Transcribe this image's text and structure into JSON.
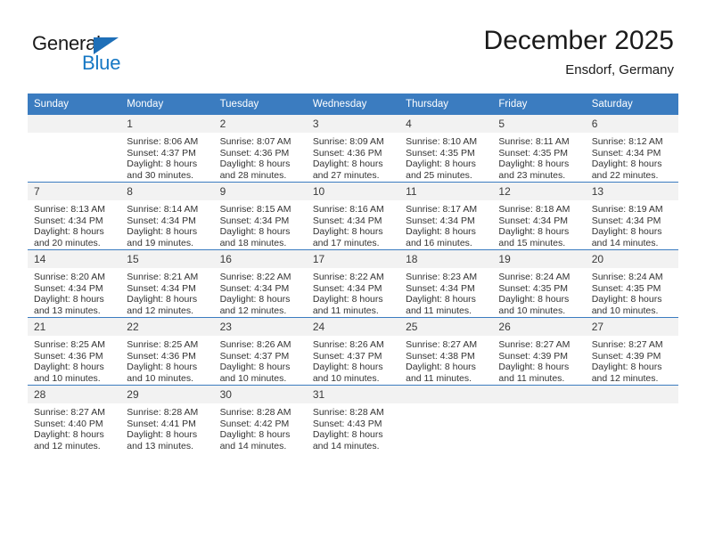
{
  "brand": {
    "name_top": "General",
    "name_bottom": "Blue",
    "triangle_color": "#1e6fb8",
    "blue_text_color": "#1577c4"
  },
  "header": {
    "title": "December 2025",
    "location": "Ensdorf, Germany"
  },
  "theme": {
    "header_blue": "#3b7cc0",
    "daynum_band": "#f2f2f2",
    "text": "#333333"
  },
  "calendar": {
    "weekday_headers": [
      "Sunday",
      "Monday",
      "Tuesday",
      "Wednesday",
      "Thursday",
      "Friday",
      "Saturday"
    ],
    "labels": {
      "sunrise": "Sunrise:",
      "sunset": "Sunset:",
      "daylight": "Daylight:"
    },
    "weeks": [
      [
        {
          "day": "",
          "empty": true,
          "l1": "",
          "l2": "",
          "l3": "",
          "l4": ""
        },
        {
          "day": "1",
          "l1": "Sunrise: 8:06 AM",
          "l2": "Sunset: 4:37 PM",
          "l3": "Daylight: 8 hours",
          "l4": "and 30 minutes."
        },
        {
          "day": "2",
          "l1": "Sunrise: 8:07 AM",
          "l2": "Sunset: 4:36 PM",
          "l3": "Daylight: 8 hours",
          "l4": "and 28 minutes."
        },
        {
          "day": "3",
          "l1": "Sunrise: 8:09 AM",
          "l2": "Sunset: 4:36 PM",
          "l3": "Daylight: 8 hours",
          "l4": "and 27 minutes."
        },
        {
          "day": "4",
          "l1": "Sunrise: 8:10 AM",
          "l2": "Sunset: 4:35 PM",
          "l3": "Daylight: 8 hours",
          "l4": "and 25 minutes."
        },
        {
          "day": "5",
          "l1": "Sunrise: 8:11 AM",
          "l2": "Sunset: 4:35 PM",
          "l3": "Daylight: 8 hours",
          "l4": "and 23 minutes."
        },
        {
          "day": "6",
          "l1": "Sunrise: 8:12 AM",
          "l2": "Sunset: 4:34 PM",
          "l3": "Daylight: 8 hours",
          "l4": "and 22 minutes."
        }
      ],
      [
        {
          "day": "7",
          "l1": "Sunrise: 8:13 AM",
          "l2": "Sunset: 4:34 PM",
          "l3": "Daylight: 8 hours",
          "l4": "and 20 minutes."
        },
        {
          "day": "8",
          "l1": "Sunrise: 8:14 AM",
          "l2": "Sunset: 4:34 PM",
          "l3": "Daylight: 8 hours",
          "l4": "and 19 minutes."
        },
        {
          "day": "9",
          "l1": "Sunrise: 8:15 AM",
          "l2": "Sunset: 4:34 PM",
          "l3": "Daylight: 8 hours",
          "l4": "and 18 minutes."
        },
        {
          "day": "10",
          "l1": "Sunrise: 8:16 AM",
          "l2": "Sunset: 4:34 PM",
          "l3": "Daylight: 8 hours",
          "l4": "and 17 minutes."
        },
        {
          "day": "11",
          "l1": "Sunrise: 8:17 AM",
          "l2": "Sunset: 4:34 PM",
          "l3": "Daylight: 8 hours",
          "l4": "and 16 minutes."
        },
        {
          "day": "12",
          "l1": "Sunrise: 8:18 AM",
          "l2": "Sunset: 4:34 PM",
          "l3": "Daylight: 8 hours",
          "l4": "and 15 minutes."
        },
        {
          "day": "13",
          "l1": "Sunrise: 8:19 AM",
          "l2": "Sunset: 4:34 PM",
          "l3": "Daylight: 8 hours",
          "l4": "and 14 minutes."
        }
      ],
      [
        {
          "day": "14",
          "l1": "Sunrise: 8:20 AM",
          "l2": "Sunset: 4:34 PM",
          "l3": "Daylight: 8 hours",
          "l4": "and 13 minutes."
        },
        {
          "day": "15",
          "l1": "Sunrise: 8:21 AM",
          "l2": "Sunset: 4:34 PM",
          "l3": "Daylight: 8 hours",
          "l4": "and 12 minutes."
        },
        {
          "day": "16",
          "l1": "Sunrise: 8:22 AM",
          "l2": "Sunset: 4:34 PM",
          "l3": "Daylight: 8 hours",
          "l4": "and 12 minutes."
        },
        {
          "day": "17",
          "l1": "Sunrise: 8:22 AM",
          "l2": "Sunset: 4:34 PM",
          "l3": "Daylight: 8 hours",
          "l4": "and 11 minutes."
        },
        {
          "day": "18",
          "l1": "Sunrise: 8:23 AM",
          "l2": "Sunset: 4:34 PM",
          "l3": "Daylight: 8 hours",
          "l4": "and 11 minutes."
        },
        {
          "day": "19",
          "l1": "Sunrise: 8:24 AM",
          "l2": "Sunset: 4:35 PM",
          "l3": "Daylight: 8 hours",
          "l4": "and 10 minutes."
        },
        {
          "day": "20",
          "l1": "Sunrise: 8:24 AM",
          "l2": "Sunset: 4:35 PM",
          "l3": "Daylight: 8 hours",
          "l4": "and 10 minutes."
        }
      ],
      [
        {
          "day": "21",
          "l1": "Sunrise: 8:25 AM",
          "l2": "Sunset: 4:36 PM",
          "l3": "Daylight: 8 hours",
          "l4": "and 10 minutes."
        },
        {
          "day": "22",
          "l1": "Sunrise: 8:25 AM",
          "l2": "Sunset: 4:36 PM",
          "l3": "Daylight: 8 hours",
          "l4": "and 10 minutes."
        },
        {
          "day": "23",
          "l1": "Sunrise: 8:26 AM",
          "l2": "Sunset: 4:37 PM",
          "l3": "Daylight: 8 hours",
          "l4": "and 10 minutes."
        },
        {
          "day": "24",
          "l1": "Sunrise: 8:26 AM",
          "l2": "Sunset: 4:37 PM",
          "l3": "Daylight: 8 hours",
          "l4": "and 10 minutes."
        },
        {
          "day": "25",
          "l1": "Sunrise: 8:27 AM",
          "l2": "Sunset: 4:38 PM",
          "l3": "Daylight: 8 hours",
          "l4": "and 11 minutes."
        },
        {
          "day": "26",
          "l1": "Sunrise: 8:27 AM",
          "l2": "Sunset: 4:39 PM",
          "l3": "Daylight: 8 hours",
          "l4": "and 11 minutes."
        },
        {
          "day": "27",
          "l1": "Sunrise: 8:27 AM",
          "l2": "Sunset: 4:39 PM",
          "l3": "Daylight: 8 hours",
          "l4": "and 12 minutes."
        }
      ],
      [
        {
          "day": "28",
          "l1": "Sunrise: 8:27 AM",
          "l2": "Sunset: 4:40 PM",
          "l3": "Daylight: 8 hours",
          "l4": "and 12 minutes."
        },
        {
          "day": "29",
          "l1": "Sunrise: 8:28 AM",
          "l2": "Sunset: 4:41 PM",
          "l3": "Daylight: 8 hours",
          "l4": "and 13 minutes."
        },
        {
          "day": "30",
          "l1": "Sunrise: 8:28 AM",
          "l2": "Sunset: 4:42 PM",
          "l3": "Daylight: 8 hours",
          "l4": "and 14 minutes."
        },
        {
          "day": "31",
          "l1": "Sunrise: 8:28 AM",
          "l2": "Sunset: 4:43 PM",
          "l3": "Daylight: 8 hours",
          "l4": "and 14 minutes."
        },
        {
          "day": "",
          "empty": true,
          "l1": "",
          "l2": "",
          "l3": "",
          "l4": ""
        },
        {
          "day": "",
          "empty": true,
          "l1": "",
          "l2": "",
          "l3": "",
          "l4": ""
        },
        {
          "day": "",
          "empty": true,
          "l1": "",
          "l2": "",
          "l3": "",
          "l4": ""
        }
      ]
    ]
  }
}
